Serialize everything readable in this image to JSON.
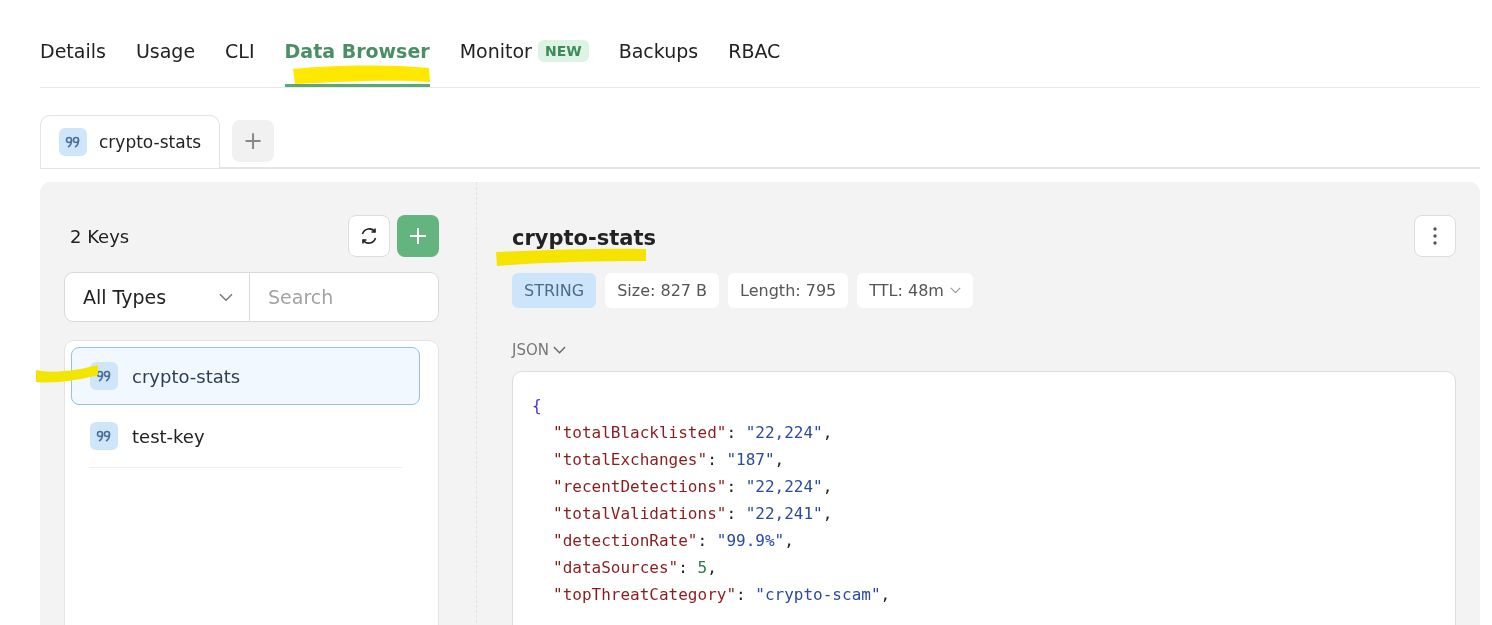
{
  "nav_tabs": [
    {
      "label": "Details",
      "selected": false
    },
    {
      "label": "Usage",
      "selected": false
    },
    {
      "label": "CLI",
      "selected": false
    },
    {
      "label": "Data Browser",
      "selected": true
    },
    {
      "label": "Monitor",
      "selected": false,
      "badge": "NEW"
    },
    {
      "label": "Backups",
      "selected": false
    },
    {
      "label": "RBAC",
      "selected": false
    }
  ],
  "open_tabs": [
    {
      "label": "crypto-stats",
      "selected": true
    }
  ],
  "add_tab": "+",
  "sidebar": {
    "count": "2 Keys",
    "type_filter": "All Types",
    "search": {
      "placeholder": "Search"
    },
    "keys": [
      {
        "name": "crypto-stats",
        "selected": true
      },
      {
        "name": "test-key",
        "selected": false
      }
    ]
  },
  "detail": {
    "title": "crypto-stats",
    "type": "STRING",
    "meta": [
      {
        "label": "Size:",
        "value": "827 B",
        "dropdown": false
      },
      {
        "label": "Length:",
        "value": "795",
        "dropdown": false
      },
      {
        "label": "TTL:",
        "value": "48m",
        "dropdown": true
      }
    ],
    "format": "JSON",
    "lines": [
      [
        {
          "kind": "brace",
          "text": "{"
        }
      ],
      [
        {
          "kind": "key",
          "text": "\"totalBlacklisted\""
        },
        {
          "kind": "punct",
          "text": ": "
        },
        {
          "kind": "string",
          "text": "\"22,224\""
        },
        {
          "kind": "punct",
          "text": ","
        }
      ],
      [
        {
          "kind": "key",
          "text": "\"totalExchanges\""
        },
        {
          "kind": "punct",
          "text": ": "
        },
        {
          "kind": "string",
          "text": "\"187\""
        },
        {
          "kind": "punct",
          "text": ","
        }
      ],
      [
        {
          "kind": "key",
          "text": "\"recentDetections\""
        },
        {
          "kind": "punct",
          "text": ": "
        },
        {
          "kind": "string",
          "text": "\"22,224\""
        },
        {
          "kind": "punct",
          "text": ","
        }
      ],
      [
        {
          "kind": "key",
          "text": "\"totalValidations\""
        },
        {
          "kind": "punct",
          "text": ": "
        },
        {
          "kind": "string",
          "text": "\"22,241\""
        },
        {
          "kind": "punct",
          "text": ","
        }
      ],
      [
        {
          "kind": "key",
          "text": "\"detectionRate\""
        },
        {
          "kind": "punct",
          "text": ": "
        },
        {
          "kind": "string",
          "text": "\"99.9%\""
        },
        {
          "kind": "punct",
          "text": ","
        }
      ],
      [
        {
          "kind": "key",
          "text": "\"dataSources\""
        },
        {
          "kind": "punct",
          "text": ": "
        },
        {
          "kind": "number",
          "text": "5"
        },
        {
          "kind": "punct",
          "text": ","
        }
      ],
      [
        {
          "kind": "key",
          "text": "\"topThreatCategory\""
        },
        {
          "kind": "punct",
          "text": ": "
        },
        {
          "kind": "string",
          "text": "\"crypto-scam\""
        },
        {
          "kind": "punct",
          "text": ","
        }
      ]
    ]
  }
}
